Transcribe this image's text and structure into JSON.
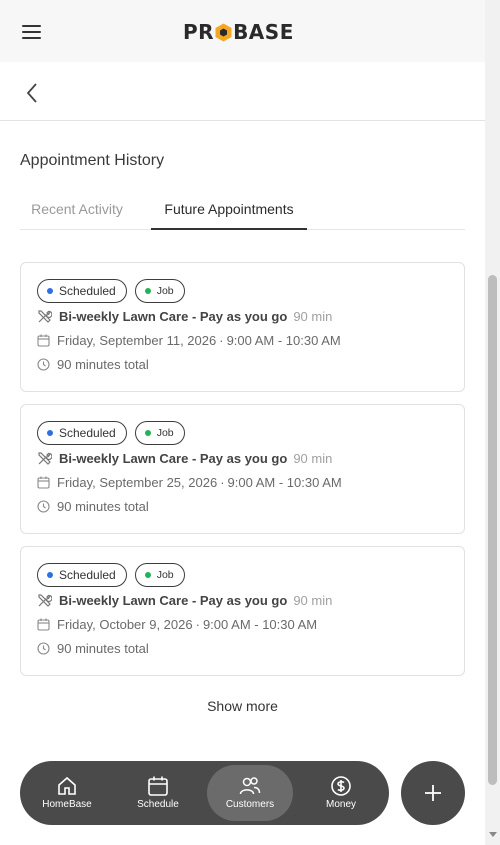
{
  "header": {
    "logo_text": "PROBASE",
    "brand_accent": "#f5a623"
  },
  "history": {
    "title": "Appointment History",
    "tabs": [
      {
        "label": "Recent Activity",
        "active": false
      },
      {
        "label": "Future Appointments",
        "active": true
      }
    ]
  },
  "appointments": [
    {
      "status": "Scheduled",
      "status_color": "#2f6fe4",
      "type": "Job",
      "type_color": "#21b35a",
      "service": "Bi-weekly Lawn Care - Pay as you go",
      "duration": "90 min",
      "date": "Friday, September 11, 2026",
      "time": "9:00 AM - 10:30 AM",
      "total": "90 minutes total"
    },
    {
      "status": "Scheduled",
      "status_color": "#2f6fe4",
      "type": "Job",
      "type_color": "#21b35a",
      "service": "Bi-weekly Lawn Care - Pay as you go",
      "duration": "90 min",
      "date": "Friday, September 25, 2026",
      "time": "9:00 AM - 10:30 AM",
      "total": "90 minutes total"
    },
    {
      "status": "Scheduled",
      "status_color": "#2f6fe4",
      "type": "Job",
      "type_color": "#21b35a",
      "service": "Bi-weekly Lawn Care - Pay as you go",
      "duration": "90 min",
      "date": "Friday, October 9, 2026",
      "time": "9:00 AM - 10:30 AM",
      "total": "90 minutes total"
    }
  ],
  "show_more_label": "Show more",
  "nav": {
    "items": [
      {
        "label": "HomeBase",
        "icon": "home-icon",
        "active": false
      },
      {
        "label": "Schedule",
        "icon": "calendar-icon",
        "active": false
      },
      {
        "label": "Customers",
        "icon": "users-icon",
        "active": true
      },
      {
        "label": "Money",
        "icon": "dollar-icon",
        "active": false
      }
    ],
    "fab_icon": "plus-icon"
  }
}
